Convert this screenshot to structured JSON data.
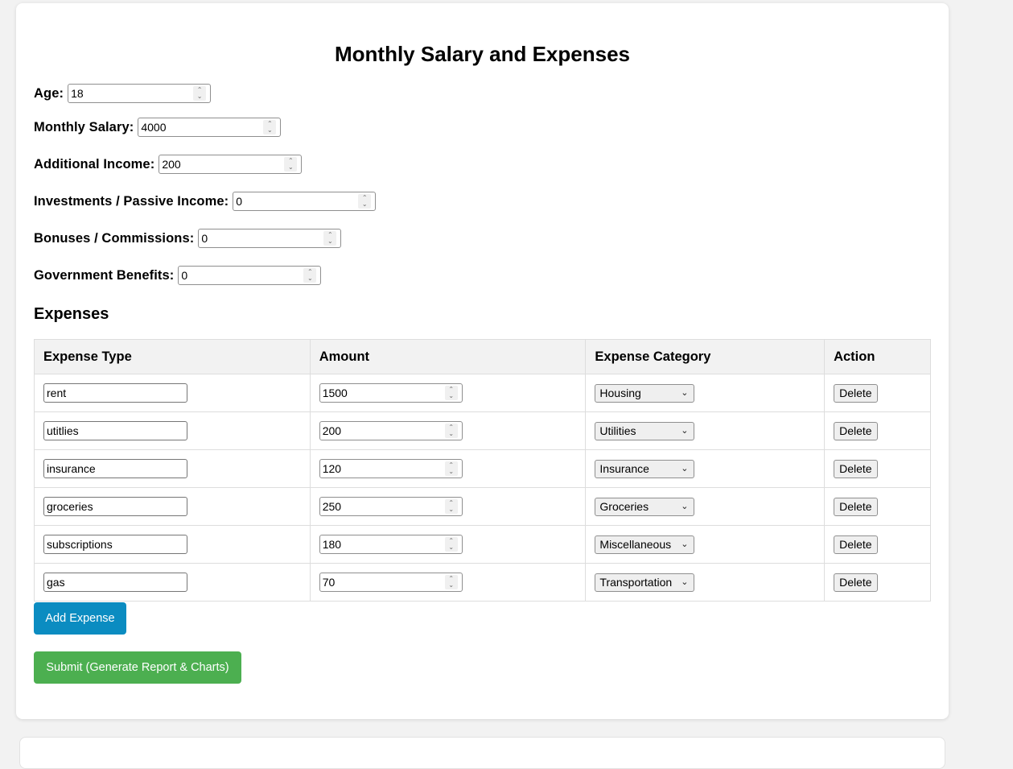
{
  "title": "Monthly Salary and Expenses",
  "fields": [
    {
      "label": "Age:",
      "value": "18"
    },
    {
      "label": "Monthly Salary:",
      "value": "4000"
    },
    {
      "label": "Additional Income:",
      "value": "200"
    },
    {
      "label": "Investments / Passive Income:",
      "value": "0"
    },
    {
      "label": "Bonuses / Commissions:",
      "value": "0"
    },
    {
      "label": "Government Benefits:",
      "value": "0"
    }
  ],
  "expenses_heading": "Expenses",
  "table": {
    "headers": [
      "Expense Type",
      "Amount",
      "Expense Category",
      "Action"
    ],
    "rows": [
      {
        "type": "rent",
        "amount": "1500",
        "category": "Housing",
        "action": "Delete"
      },
      {
        "type": "utitlies",
        "amount": "200",
        "category": "Utilities",
        "action": "Delete"
      },
      {
        "type": "insurance",
        "amount": "120",
        "category": "Insurance",
        "action": "Delete"
      },
      {
        "type": "groceries",
        "amount": "250",
        "category": "Groceries",
        "action": "Delete"
      },
      {
        "type": "subscriptions",
        "amount": "180",
        "category": "Miscellaneous",
        "action": "Delete"
      },
      {
        "type": "gas",
        "amount": "70",
        "category": "Transportation",
        "action": "Delete"
      }
    ]
  },
  "buttons": {
    "add_expense": "Add Expense",
    "submit": "Submit (Generate Report & Charts)"
  },
  "icons": {
    "spinner": "spinner-arrows-icon",
    "dropdown": "chevron-down-icon"
  },
  "colors": {
    "add_button": "#0b8cc1",
    "submit_button": "#4caf50",
    "header_bg": "#f2f2f2"
  }
}
